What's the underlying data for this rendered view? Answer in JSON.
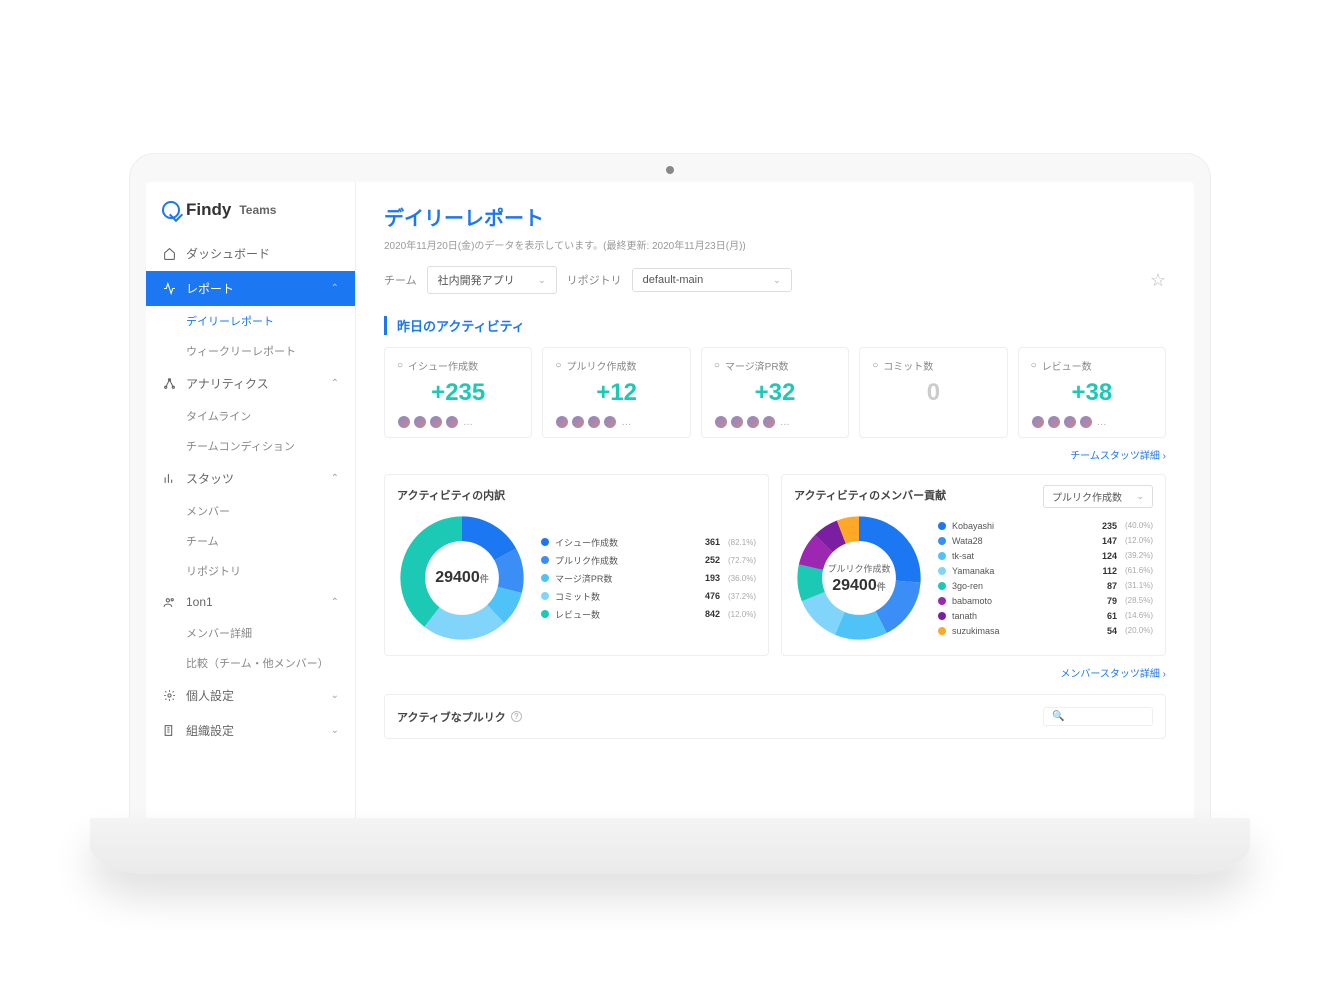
{
  "brand": {
    "name": "Findy",
    "sub": "Teams"
  },
  "sidebar": {
    "dashboard": "ダッシュボード",
    "report": "レポート",
    "report_items": [
      "デイリーレポート",
      "ウィークリーレポート"
    ],
    "analytics": "アナリティクス",
    "analytics_items": [
      "タイムライン",
      "チームコンディション"
    ],
    "stats": "スタッツ",
    "stats_items": [
      "メンバー",
      "チーム",
      "リポジトリ"
    ],
    "oneonone": "1on1",
    "oneonone_items": [
      "メンバー詳細",
      "比較（チーム・他メンバー）"
    ],
    "personal": "個人設定",
    "org": "組織設定"
  },
  "page": {
    "title": "デイリーレポート",
    "subtitle": "2020年11月20日(金)のデータを表示しています。(最終更新: 2020年11月23日(月))",
    "team_label": "チーム",
    "team_value": "社内開発アプリ",
    "repo_label": "リポジトリ",
    "repo_value": "default-main"
  },
  "section_activity": "昨日のアクティビティ",
  "stats": [
    {
      "label": "イシュー作成数",
      "value": "+235"
    },
    {
      "label": "プルリク作成数",
      "value": "+12"
    },
    {
      "label": "マージ済PR数",
      "value": "+32"
    },
    {
      "label": "コミット数",
      "value": "0",
      "zero": true
    },
    {
      "label": "レビュー数",
      "value": "+38"
    }
  ],
  "link_team_stats": "チームスタッツ詳細  ›",
  "link_member_stats": "メンバースタッツ詳細  ›",
  "breakdown": {
    "title": "アクティビティの内訳",
    "center_value": "29400",
    "center_unit": "件",
    "items": [
      {
        "name": "イシュー作成数",
        "value": 361,
        "pct": "82.1%",
        "color": "#1c77f2"
      },
      {
        "name": "プルリク作成数",
        "value": 252,
        "pct": "72.7%",
        "color": "#3b8ef5"
      },
      {
        "name": "マージ済PR数",
        "value": 193,
        "pct": "36.0%",
        "color": "#4fc3f7"
      },
      {
        "name": "コミット数",
        "value": 476,
        "pct": "37.2%",
        "color": "#81d4fa"
      },
      {
        "name": "レビュー数",
        "value": 842,
        "pct": "12.0%",
        "color": "#1cc9b5"
      }
    ]
  },
  "contribution": {
    "title": "アクティビティのメンバー貢献",
    "select": "プルリク作成数",
    "center_label": "プルリク作成数",
    "center_value": "29400",
    "center_unit": "件",
    "items": [
      {
        "name": "Kobayashi",
        "value": 235,
        "pct": "40.0%",
        "color": "#1c77f2"
      },
      {
        "name": "Wata28",
        "value": 147,
        "pct": "12.0%",
        "color": "#3b8ef5"
      },
      {
        "name": "tk-sat",
        "value": 124,
        "pct": "39.2%",
        "color": "#4fc3f7"
      },
      {
        "name": "Yamanaka",
        "value": 112,
        "pct": "61.6%",
        "color": "#81d4fa"
      },
      {
        "name": "3go-ren",
        "value": 87,
        "pct": "31.1%",
        "color": "#1cc9b5"
      },
      {
        "name": "babamoto",
        "value": 79,
        "pct": "28.5%",
        "color": "#9c27b0"
      },
      {
        "name": "tanath",
        "value": 61,
        "pct": "14.6%",
        "color": "#7b1fa2"
      },
      {
        "name": "suzukimasa",
        "value": 54,
        "pct": "20.0%",
        "color": "#ffa726"
      }
    ]
  },
  "active_pr": {
    "title": "アクティブなプルリク"
  },
  "chart_data": [
    {
      "type": "pie",
      "title": "アクティビティの内訳",
      "center_total": 29400,
      "series": [
        {
          "name": "イシュー作成数",
          "value": 361
        },
        {
          "name": "プルリク作成数",
          "value": 252
        },
        {
          "name": "マージ済PR数",
          "value": 193
        },
        {
          "name": "コミット数",
          "value": 476
        },
        {
          "name": "レビュー数",
          "value": 842
        }
      ]
    },
    {
      "type": "pie",
      "title": "アクティビティのメンバー貢献 — プルリク作成数",
      "center_total": 29400,
      "series": [
        {
          "name": "Kobayashi",
          "value": 235
        },
        {
          "name": "Wata28",
          "value": 147
        },
        {
          "name": "tk-sat",
          "value": 124
        },
        {
          "name": "Yamanaka",
          "value": 112
        },
        {
          "name": "3go-ren",
          "value": 87
        },
        {
          "name": "babamoto",
          "value": 79
        },
        {
          "name": "tanath",
          "value": 61
        },
        {
          "name": "suzukimasa",
          "value": 54
        }
      ]
    }
  ]
}
